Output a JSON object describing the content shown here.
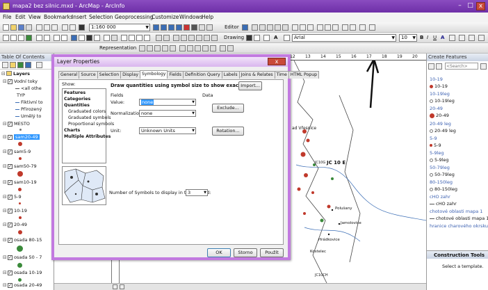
{
  "window": {
    "title": "mapa2 bez silnic.mxd - ArcMap - ArcInfo",
    "minimize": "–",
    "maximize": "□",
    "close": "x"
  },
  "menu": [
    "File",
    "Edit",
    "View",
    "Bookmarks",
    "Insert",
    "Selection",
    "Geoprocessing",
    "Customize",
    "Windows",
    "Help"
  ],
  "toolbar": {
    "scale": "1:160 000",
    "editor_label": "Editor",
    "drawing_label": "Drawing",
    "font_name": "Arial",
    "font_size": "10",
    "representation_label": "Representation",
    "bold": "B",
    "italic": "I",
    "underline": "U"
  },
  "toc": {
    "title": "Table Of Contents",
    "layers_root": "Layers",
    "items": [
      {
        "label": "Vodní toky",
        "checked": true
      },
      {
        "label": "<all othe"
      },
      {
        "label": "TYP"
      },
      {
        "label": "Fiktivní to"
      },
      {
        "label": "Přirozený"
      },
      {
        "label": "Umělý to"
      },
      {
        "label": "MESTO",
        "checked": true
      },
      {
        "label": "sam20-49",
        "checked": true,
        "selected": true
      },
      {
        "label": "sam5-9",
        "checked": true
      },
      {
        "label": "sam50-79",
        "checked": true
      },
      {
        "label": "sam10-19",
        "checked": true
      },
      {
        "label": "5-9",
        "checked": true
      },
      {
        "label": "10-19",
        "checked": true
      },
      {
        "label": "20-49",
        "checked": true
      },
      {
        "label": "osada 80-15",
        "checked": true
      },
      {
        "label": "osada 50 - 7",
        "checked": true
      },
      {
        "label": "osada 10-19",
        "checked": true
      },
      {
        "label": "osada 20-49",
        "checked": true
      }
    ]
  },
  "ruler": [
    "12",
    "13",
    "14",
    "15",
    "16",
    "17",
    "18",
    "19",
    "20"
  ],
  "map": {
    "labels": [
      "JC 10 E",
      "JC10G",
      "Polušany",
      "Jamolovice",
      "Hrádkovice",
      "Kostelec",
      "JC10CH",
      "ad Vřesnice"
    ]
  },
  "create_features": {
    "title": "Create Features",
    "search_placeholder": "<Search>",
    "items": [
      {
        "label": "10-19",
        "kind": "header"
      },
      {
        "label": "10-19",
        "kind": "fill"
      },
      {
        "label": "10-19leg",
        "kind": "header"
      },
      {
        "label": "10-19leg",
        "kind": "hollow"
      },
      {
        "label": "20-49",
        "kind": "header"
      },
      {
        "label": "20-49",
        "kind": "fill"
      },
      {
        "label": "20-49 leg",
        "kind": "header"
      },
      {
        "label": "20-49 leg",
        "kind": "hollow"
      },
      {
        "label": "5-9",
        "kind": "header"
      },
      {
        "label": "5-9",
        "kind": "fill"
      },
      {
        "label": "5-9leg",
        "kind": "header"
      },
      {
        "label": "5-9leg",
        "kind": "hollow"
      },
      {
        "label": "50-79leg",
        "kind": "header"
      },
      {
        "label": "50-79leg",
        "kind": "hollow"
      },
      {
        "label": "80-150leg",
        "kind": "header"
      },
      {
        "label": "80-150leg",
        "kind": "hollow"
      },
      {
        "label": "cHO zahr",
        "kind": "header"
      },
      {
        "label": "cHO zahr",
        "kind": "line"
      },
      {
        "label": "chotové oblasti mapa 1",
        "kind": "header"
      },
      {
        "label": "chotové oblasti mapa 1",
        "kind": "line"
      },
      {
        "label": "hranice charového okrsku",
        "kind": "header"
      }
    ],
    "construction_tools_title": "Construction Tools",
    "construction_message": "Select a template."
  },
  "dialog": {
    "title": "Layer Properties",
    "tabs": [
      "General",
      "Source",
      "Selection",
      "Display",
      "Symbology",
      "Fields",
      "Definition Query",
      "Labels",
      "Joins & Relates",
      "Time",
      "HTML Popup"
    ],
    "active_tab": "Symbology",
    "show_label": "Show:",
    "show_items": [
      {
        "label": "Features",
        "style": "b"
      },
      {
        "label": "Categories",
        "style": "b"
      },
      {
        "label": "Quantities",
        "style": "b"
      },
      {
        "label": "Graduated colors",
        "style": "sub"
      },
      {
        "label": "Graduated symbols",
        "style": "sub"
      },
      {
        "label": "Proportional symbols",
        "style": "sub"
      },
      {
        "label": "Charts",
        "style": "b"
      },
      {
        "label": "Multiple Attributes",
        "style": "b"
      }
    ],
    "heading": "Draw quantities using symbol size to show exact values.",
    "import_button": "Import...",
    "fields_label": "Fields",
    "data_label": "Data",
    "value_label": "Value:",
    "value_selected": "none",
    "normalization_label": "Normalization:",
    "normalization_selected": "none",
    "exclude_button": "Exclude...",
    "unit_label": "Unit:",
    "unit_selected": "Unknown Units",
    "rotation_button": "Rotation...",
    "symbols_count_label": "Number of Symbols to display in the Legend:",
    "symbols_count": "3",
    "ok": "OK",
    "cancel": "Storno",
    "apply": "Použít"
  },
  "colors": {
    "title_bar": "#7a3bb4",
    "dialog_border": "#c27ae0",
    "selection": "#3399ff",
    "point_red": "#c0392b"
  }
}
